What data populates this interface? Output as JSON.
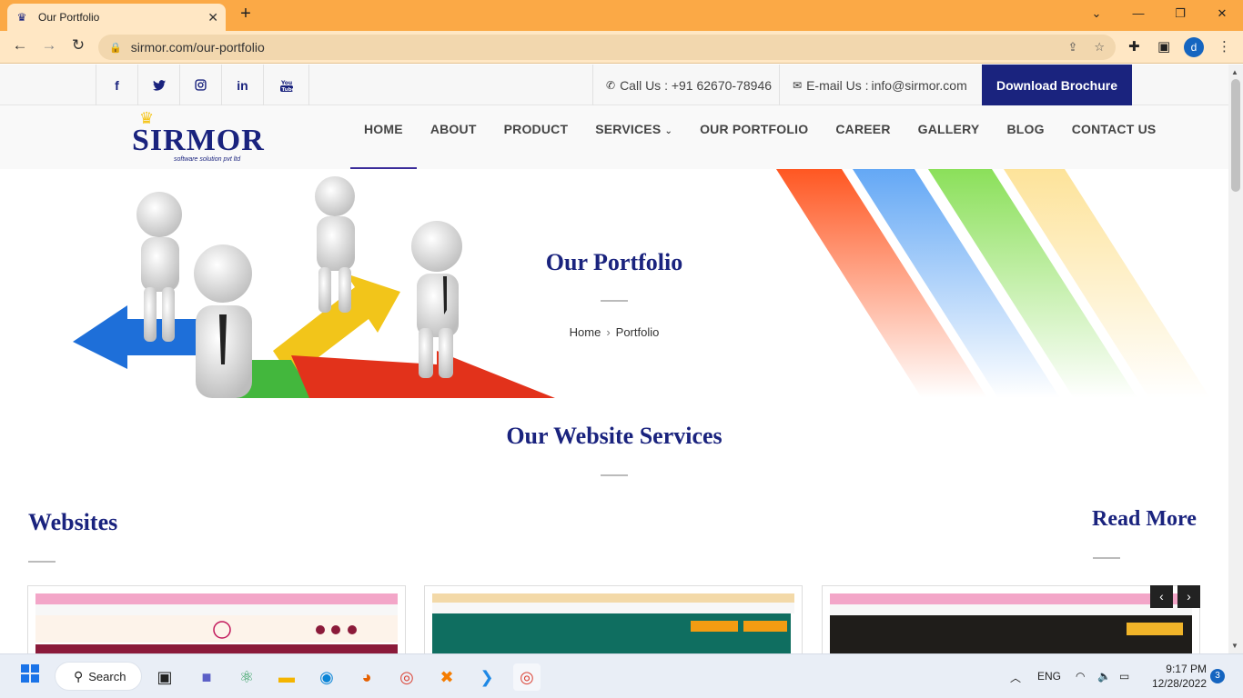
{
  "browser": {
    "tab_title": "Our Portfolio",
    "url": "sirmor.com/our-portfolio",
    "profile_initial": "d"
  },
  "topbar": {
    "social": [
      "f",
      "t",
      "ig",
      "in",
      "yt"
    ],
    "call_label": "Call Us : +91 62670-78946",
    "email_label": "E-mail Us : ",
    "email": "info@sirmor.com",
    "brochure": "Download Brochure"
  },
  "logo": {
    "word": "SIRMOR",
    "tagline": "software solution pvt ltd"
  },
  "menu": [
    "HOME",
    "ABOUT",
    "PRODUCT",
    "SERVICES",
    "OUR PORTFOLIO",
    "CAREER",
    "GALLERY",
    "BLOG",
    "CONTACT US"
  ],
  "hero": {
    "title": "Our Portfolio",
    "crumb_home": "Home",
    "crumb_current": "Portfolio"
  },
  "services": {
    "title": "Our Website Services",
    "section": "Websites",
    "read_more": "Read More"
  },
  "taskbar": {
    "search": "Search",
    "lang": "ENG",
    "time": "9:17 PM",
    "date": "12/28/2022",
    "notifications": "3"
  },
  "colors": {
    "brand_navy": "#1a237e",
    "tab_orange": "#fba946"
  }
}
